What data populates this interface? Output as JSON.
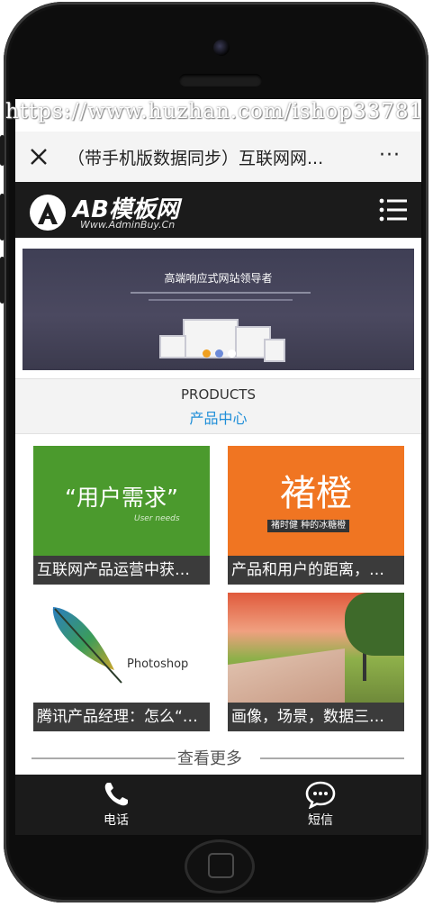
{
  "watermark": "https://www.huzhan.com/ishop33781",
  "navbar": {
    "title": "（带手机版数据同步）互联网网...",
    "more": "···"
  },
  "header": {
    "logo_text": "AB模板网",
    "logo_sub": "Www.AdminBuy.Cn",
    "menu_icon": "hamburger-icon"
  },
  "banner": {
    "title": "高端响应式网站领导者"
  },
  "section": {
    "title_en": "PRODUCTS",
    "title_cn": "产品中心"
  },
  "products": [
    {
      "image_text": "“用户需求”",
      "image_sub": "User needs",
      "caption": "互联网产品运营中获…",
      "bg": "#4b9a2d"
    },
    {
      "image_text": "褚橙",
      "image_sub": "褚时健  种的冰糖橙",
      "caption": "产品和用户的距离，…",
      "bg": "#f07522"
    },
    {
      "image_text": "Photoshop",
      "caption": "腾讯产品经理：怎么“…",
      "bg": "#ffffff"
    },
    {
      "caption": "画像，场景，数据三…",
      "bg": "#b65a43"
    }
  ],
  "view_more": "查看更多",
  "tabbar": {
    "call_label": "电话",
    "sms_label": "短信"
  },
  "colors": {
    "accent": "#1e8ed8",
    "header_bg": "#1b1b1b"
  }
}
